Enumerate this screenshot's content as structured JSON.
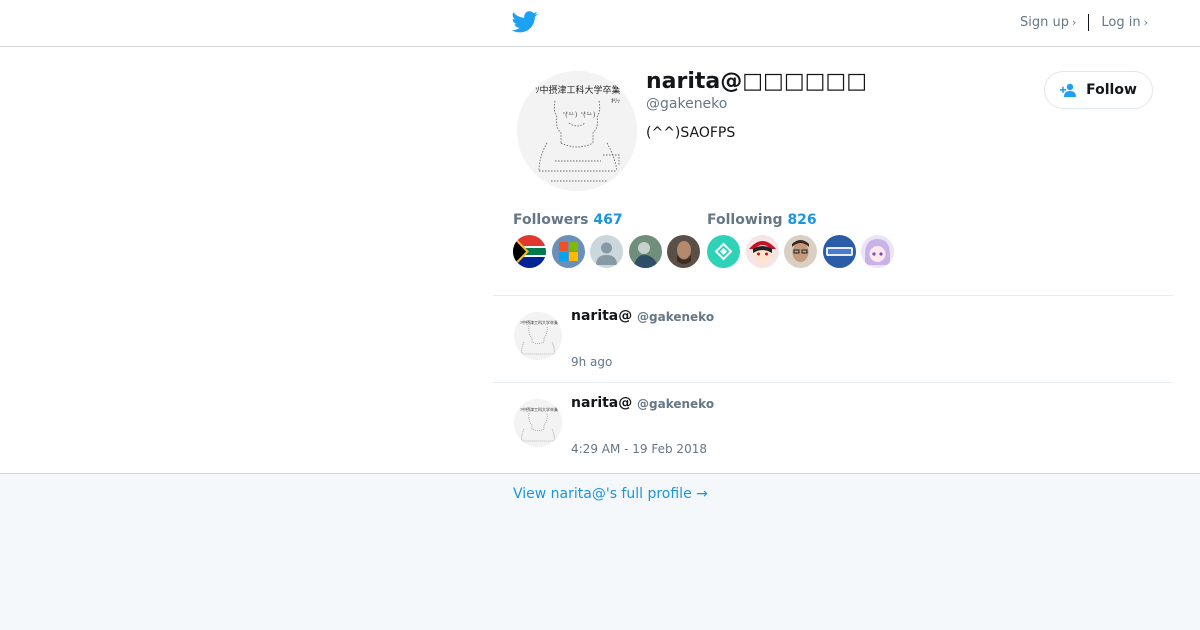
{
  "header": {
    "logo_icon": "twitter-bird-icon",
    "signup_label": "Sign up",
    "login_label": "Log in",
    "chevron": "›"
  },
  "profile": {
    "name": "narita@□□□□□□",
    "handle": "@gakeneko",
    "bio": "(^^)SAOFPS",
    "follow_label": "Follow",
    "followers_label": "Followers",
    "followers_count": "467",
    "following_label": "Following",
    "following_count": "826"
  },
  "tweets": [
    {
      "name": "narita@",
      "handle": "@gakeneko",
      "time": "9h ago"
    },
    {
      "name": "narita@",
      "handle": "@gakeneko",
      "time": "4:29 AM - 19 Feb 2018"
    }
  ],
  "footer": {
    "full_profile_link": "View narita@'s full profile →"
  },
  "colors": {
    "accent": "#1b95e0",
    "twitter_blue": "#1da1f2",
    "muted": "#657786",
    "page_bg": "#f5f8fa"
  }
}
